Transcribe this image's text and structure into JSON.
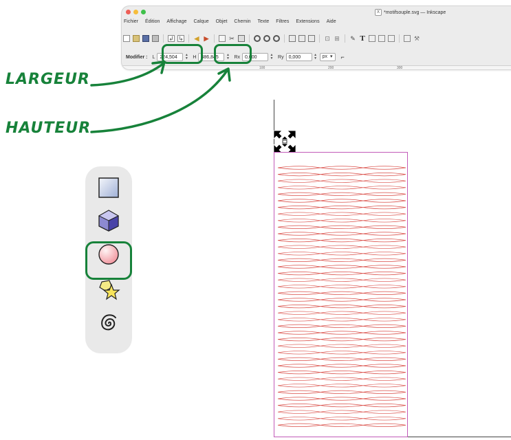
{
  "window": {
    "title": "*motifsouple.svg — Inkscape",
    "menu": [
      "Fichier",
      "Édition",
      "Affichage",
      "Calque",
      "Objet",
      "Chemin",
      "Texte",
      "Filtres",
      "Extensions",
      "Aide"
    ]
  },
  "toolbar": {
    "icons": [
      "new-document-icon",
      "open-folder-icon",
      "save-icon",
      "print-icon",
      "import-icon",
      "export-icon",
      "undo-icon",
      "redo-icon",
      "copy-icon",
      "cut-icon",
      "paste-icon",
      "zoom-selection-icon",
      "zoom-drawing-icon",
      "zoom-page-icon",
      "duplicate-icon",
      "clone-icon",
      "unlink-clone-icon",
      "group-icon",
      "ungroup-icon",
      "fill-stroke-icon",
      "text-font-icon",
      "xml-editor-icon",
      "align-icon",
      "transform-icon",
      "preferences-icon",
      "document-properties-icon"
    ]
  },
  "controls": {
    "modifier_label": "Modifier :",
    "l_label": "L",
    "width_value": "224,504",
    "h_label": "H",
    "height_value": "486,845",
    "rx_label": "Rx",
    "rx_value": "0,000",
    "ry_label": "Ry",
    "ry_value": "0,000",
    "unit": "px",
    "ruler_marks": [
      "100",
      "200",
      "300"
    ]
  },
  "annotations": {
    "width_label": "LARGEUR",
    "height_label": "HAUTEUR",
    "color": "#17823a"
  },
  "palette": {
    "tools": [
      "rectangle-tool-icon",
      "3d-box-tool-icon",
      "ellipse-tool-icon",
      "star-polygon-tool-icon",
      "spiral-tool-icon"
    ],
    "selected": "ellipse-tool-icon"
  },
  "canvas": {
    "pattern_color": "#d94b45",
    "selection_color": "#c15ab8",
    "pattern_columns": 3,
    "pattern_rows": 40
  }
}
